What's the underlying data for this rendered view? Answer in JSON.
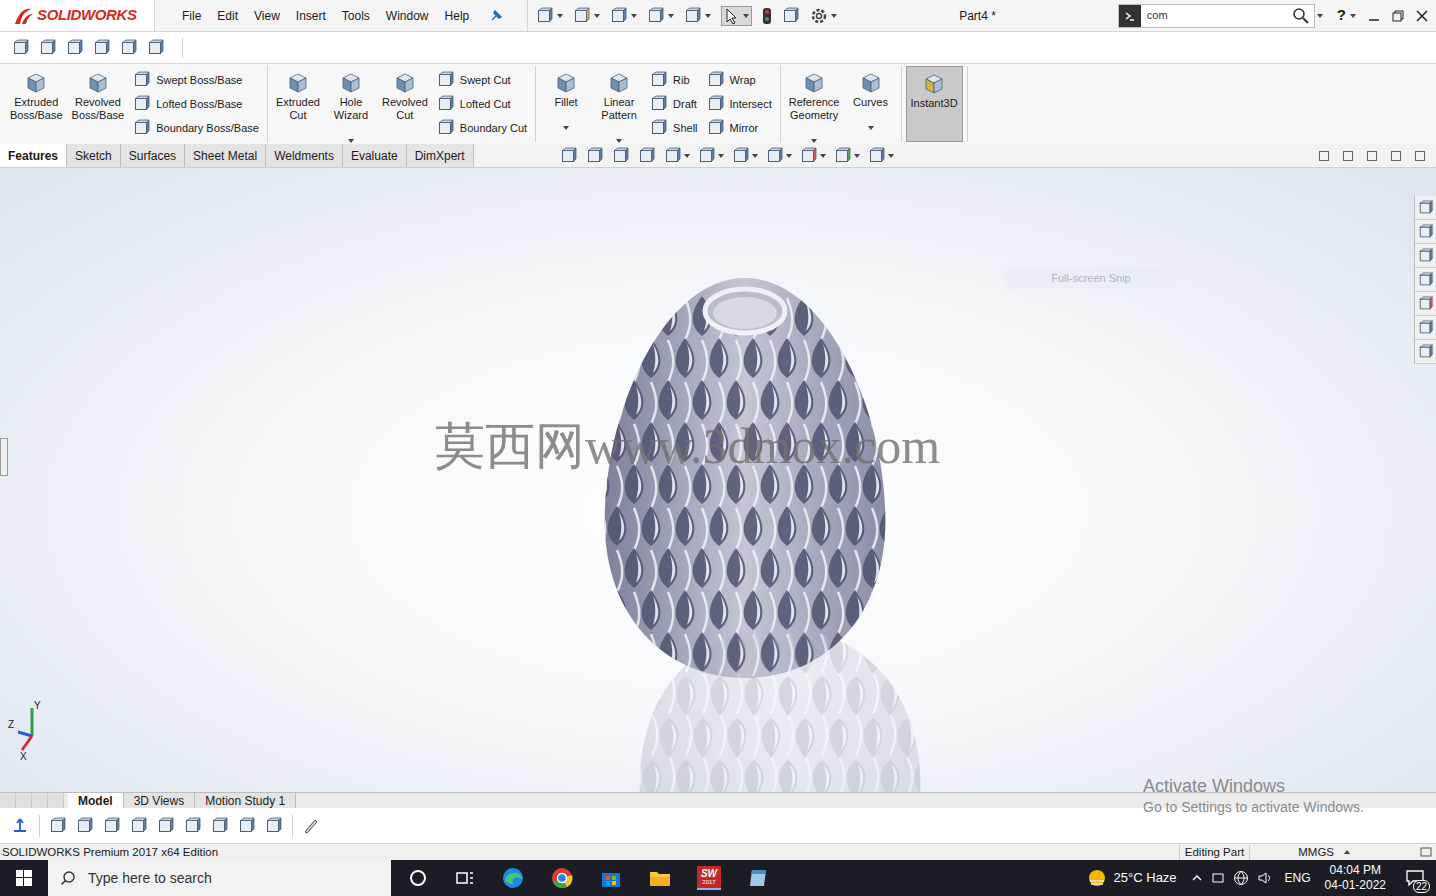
{
  "app": {
    "logo": "SOLIDWORKS",
    "title": "Part4 *"
  },
  "menu": [
    "File",
    "Edit",
    "View",
    "Insert",
    "Tools",
    "Window",
    "Help"
  ],
  "search": {
    "value": "com"
  },
  "help": "?",
  "ribbon_groups": [
    [
      {
        "kind": "large",
        "lines": [
          "Extruded",
          "Boss/Base"
        ],
        "dropdown": false,
        "selected": false
      },
      {
        "kind": "large",
        "lines": [
          "Revolved",
          "Boss/Base"
        ],
        "dropdown": false,
        "selected": false
      },
      {
        "kind": "stack",
        "items": [
          "Swept Boss/Base",
          "Lofted Boss/Base",
          "Boundary Boss/Base"
        ]
      }
    ],
    [
      {
        "kind": "large",
        "lines": [
          "Extruded",
          "Cut"
        ],
        "dropdown": false,
        "selected": false
      },
      {
        "kind": "large",
        "lines": [
          "Hole",
          "Wizard"
        ],
        "dropdown": true,
        "selected": false
      },
      {
        "kind": "large",
        "lines": [
          "Revolved",
          "Cut"
        ],
        "dropdown": false,
        "selected": false
      },
      {
        "kind": "stack",
        "items": [
          "Swept Cut",
          "Lofted Cut",
          "Boundary Cut"
        ]
      }
    ],
    [
      {
        "kind": "large",
        "lines": [
          "Fillet"
        ],
        "dropdown": true,
        "selected": false
      },
      {
        "kind": "large",
        "lines": [
          "Linear",
          "Pattern"
        ],
        "dropdown": true,
        "selected": false
      },
      {
        "kind": "stack",
        "items": [
          "Rib",
          "Draft",
          "Shell"
        ]
      },
      {
        "kind": "stack",
        "items": [
          "Wrap",
          "Intersect",
          "Mirror"
        ]
      }
    ],
    [
      {
        "kind": "large",
        "lines": [
          "Reference",
          "Geometry"
        ],
        "dropdown": true,
        "selected": false
      },
      {
        "kind": "large",
        "lines": [
          "Curves"
        ],
        "dropdown": true,
        "selected": false
      }
    ],
    [
      {
        "kind": "large",
        "lines": [
          "Instant3D"
        ],
        "dropdown": false,
        "selected": true
      }
    ]
  ],
  "tabs": [
    {
      "label": "Features",
      "selected": true
    },
    {
      "label": "Sketch",
      "selected": false
    },
    {
      "label": "Surfaces",
      "selected": false
    },
    {
      "label": "Sheet Metal",
      "selected": false
    },
    {
      "label": "Weldments",
      "selected": false
    },
    {
      "label": "Evaluate",
      "selected": false
    },
    {
      "label": "DimXpert",
      "selected": false
    }
  ],
  "viewport": {
    "watermark": "莫西网www.3dmox.com",
    "snip_hint": "Full-screen Snip",
    "triad": {
      "y": "Y",
      "z": "Z",
      "x": "X"
    }
  },
  "activation": {
    "title": "Activate Windows",
    "subtitle": "Go to Settings to activate Windows."
  },
  "bottom_tabs": [
    {
      "label": "Model",
      "selected": true
    },
    {
      "label": "3D Views",
      "selected": false
    },
    {
      "label": "Motion Study 1",
      "selected": false
    }
  ],
  "status_bar": {
    "edition": "SOLIDWORKS Premium 2017 x64 Edition",
    "mode": "Editing Part",
    "units": "MMGS"
  },
  "taskbar": {
    "search_placeholder": "Type here to search",
    "sw_icon": {
      "label": "SW",
      "year": "2017"
    },
    "weather": "25°C Haze",
    "language": "ENG",
    "time": "04:04 PM",
    "date": "04-01-2022",
    "notifications": "22"
  }
}
